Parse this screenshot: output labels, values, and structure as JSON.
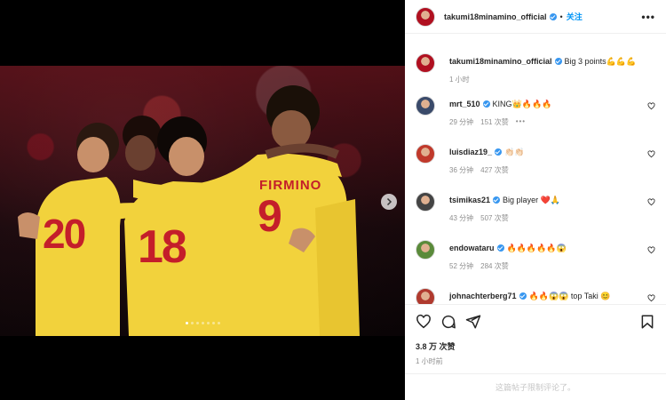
{
  "post": {
    "author": "takumi18minamino_official",
    "follow_label": "关注",
    "separator": "•",
    "more_label": "•••",
    "caption_text": "Big 3 points💪💪💪",
    "caption_time": "1 小时",
    "like_count": "3.8 万 次赞",
    "post_time": "1 小时前",
    "comments_disabled": "这篇帖子限制评论了。"
  },
  "media": {
    "slide_count": 7,
    "active_slide": 1
  },
  "comments": [
    {
      "user": "mrt_510",
      "text": "KING👑🔥🔥🔥",
      "time": "29 分钟",
      "likes": "151 次赞",
      "more": "•••",
      "avatar_color": "#3a4a6a"
    },
    {
      "user": "luisdiaz19_",
      "text": "👏🏻👏🏻",
      "time": "36 分钟",
      "likes": "427 次赞",
      "avatar_color": "#c0392b"
    },
    {
      "user": "tsimikas21",
      "text": "Big player ❤️🙏",
      "time": "43 分钟",
      "likes": "507 次赞",
      "avatar_color": "#444444"
    },
    {
      "user": "endowataru",
      "text": "🔥🔥🔥🔥🔥😱",
      "time": "52 分钟",
      "likes": "284 次赞",
      "avatar_color": "#5a8a3a"
    },
    {
      "user": "johnachterberg71",
      "text": "🔥🔥😱😱 top Taki 😊",
      "time": "",
      "likes": "",
      "avatar_color": "#b03a2e"
    }
  ],
  "jerseys": {
    "player_left": "20",
    "player_center": "18",
    "player_right_name": "FIRMINO",
    "player_right_number": "9"
  },
  "colors": {
    "follow": "#0095f6",
    "verified": "#3897f0",
    "jersey": "#f2d23c"
  }
}
